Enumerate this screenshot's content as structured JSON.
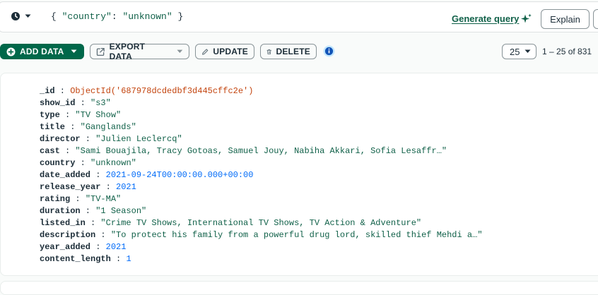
{
  "query": {
    "filter_open": "{ ",
    "filter_key": "\"country\"",
    "filter_colon": ": ",
    "filter_value": "\"unknown\"",
    "filter_close": " }",
    "generate_query_label": "Generate query",
    "explain_label": "Explain"
  },
  "toolbar": {
    "add_data_label": "ADD DATA",
    "export_data_label": "EXPORT DATA",
    "update_label": "UPDATE",
    "delete_label": "DELETE"
  },
  "pagination": {
    "page_size": "25",
    "range_text": "1 – 25 of 831"
  },
  "colors": {
    "brand_green": "#00684a",
    "link_green": "#116149",
    "objectid_orange": "#c3440e",
    "number_blue": "#016bf8"
  },
  "document": {
    "fields": [
      {
        "key": "_id",
        "value": "ObjectId('687978dcdedbf3d445cffc2e')",
        "type": "objectid"
      },
      {
        "key": "show_id",
        "value": "\"s3\"",
        "type": "string"
      },
      {
        "key": "type",
        "value": "\"TV Show\"",
        "type": "string"
      },
      {
        "key": "title",
        "value": "\"Ganglands\"",
        "type": "string"
      },
      {
        "key": "director",
        "value": "\"Julien Leclercq\"",
        "type": "string"
      },
      {
        "key": "cast",
        "value": "\"Sami Bouajila, Tracy Gotoas, Samuel Jouy, Nabiha Akkari, Sofia Lesaffr…\"",
        "type": "string"
      },
      {
        "key": "country",
        "value": "\"unknown\"",
        "type": "string"
      },
      {
        "key": "date_added",
        "value": "2021-09-24T00:00:00.000+00:00",
        "type": "date"
      },
      {
        "key": "release_year",
        "value": "2021",
        "type": "number"
      },
      {
        "key": "rating",
        "value": "\"TV-MA\"",
        "type": "string"
      },
      {
        "key": "duration",
        "value": "\"1 Season\"",
        "type": "string"
      },
      {
        "key": "listed_in",
        "value": "\"Crime TV Shows, International TV Shows, TV Action & Adventure\"",
        "type": "string"
      },
      {
        "key": "description",
        "value": "\"To protect his family from a powerful drug lord, skilled thief Mehdi a…\"",
        "type": "string"
      },
      {
        "key": "year_added",
        "value": "2021",
        "type": "number"
      },
      {
        "key": "content_length",
        "value": "1",
        "type": "number"
      }
    ]
  }
}
